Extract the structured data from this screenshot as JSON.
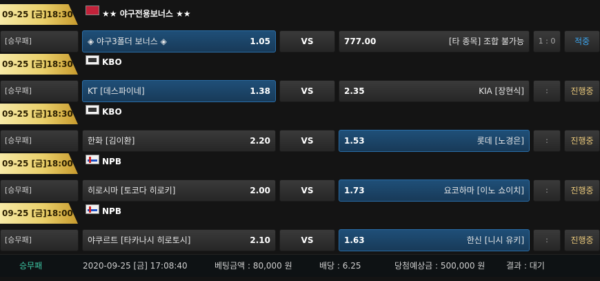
{
  "games": [
    {
      "date": "09-25 [금]18:30",
      "league_icon": "bonus-flag-icon",
      "league": "★★ 야구전용보너스 ★★",
      "bet_type": "[승무패]",
      "home": "◈ 야구3폴더 보너스 ◈",
      "home_odds": "1.05",
      "vs": "VS",
      "away": "[타 종목] 조합 불가능",
      "away_odds": "777.00",
      "score": "1 : 0",
      "status": "적중",
      "selected": "home"
    },
    {
      "date": "09-25 [금]18:30",
      "league_icon": "kbo-flag-icon",
      "league": "KBO",
      "bet_type": "[승무패]",
      "home": "KT [데스파이네]",
      "home_odds": "1.38",
      "vs": "VS",
      "away": "KIA [장현식]",
      "away_odds": "2.35",
      "score": ":",
      "status": "진행중",
      "selected": "home"
    },
    {
      "date": "09-25 [금]18:30",
      "league_icon": "kbo-flag-icon",
      "league": "KBO",
      "bet_type": "[승무패]",
      "home": "한화 [김이환]",
      "home_odds": "2.20",
      "vs": "VS",
      "away": "롯데 [노경은]",
      "away_odds": "1.53",
      "score": ":",
      "status": "진행중",
      "selected": "away"
    },
    {
      "date": "09-25 [금]18:00",
      "league_icon": "npb-flag-icon",
      "league": "NPB",
      "bet_type": "[승무패]",
      "home": "히로시마 [토코다 히로키]",
      "home_odds": "2.00",
      "vs": "VS",
      "away": "요코하마 [이노 쇼이치]",
      "away_odds": "1.73",
      "score": ":",
      "status": "진행중",
      "selected": "away"
    },
    {
      "date": "09-25 [금]18:00",
      "league_icon": "npb-flag-icon",
      "league": "NPB",
      "bet_type": "[승무패]",
      "home": "야쿠르트 [타카나시 히로토시]",
      "home_odds": "2.10",
      "vs": "VS",
      "away": "한신 [니시 유키]",
      "away_odds": "1.63",
      "score": ":",
      "status": "진행중",
      "selected": "away"
    }
  ],
  "summary": {
    "bet_type": "승무패",
    "datetime": "2020-09-25 [금] 17:08:40",
    "bet_amount": "베팅금액 : 80,000 원",
    "odds": "배당 : 6.25",
    "expected_win": "당첨예상금 : 500,000 원",
    "result": "결과 : 대기"
  },
  "colors": {
    "selected_bg": "#1f4f78",
    "gold_tab": "#e9cf6a",
    "status_hit": "#3ca6f0",
    "status_live": "#e8c77a",
    "summary_type": "#3ecaa6"
  }
}
